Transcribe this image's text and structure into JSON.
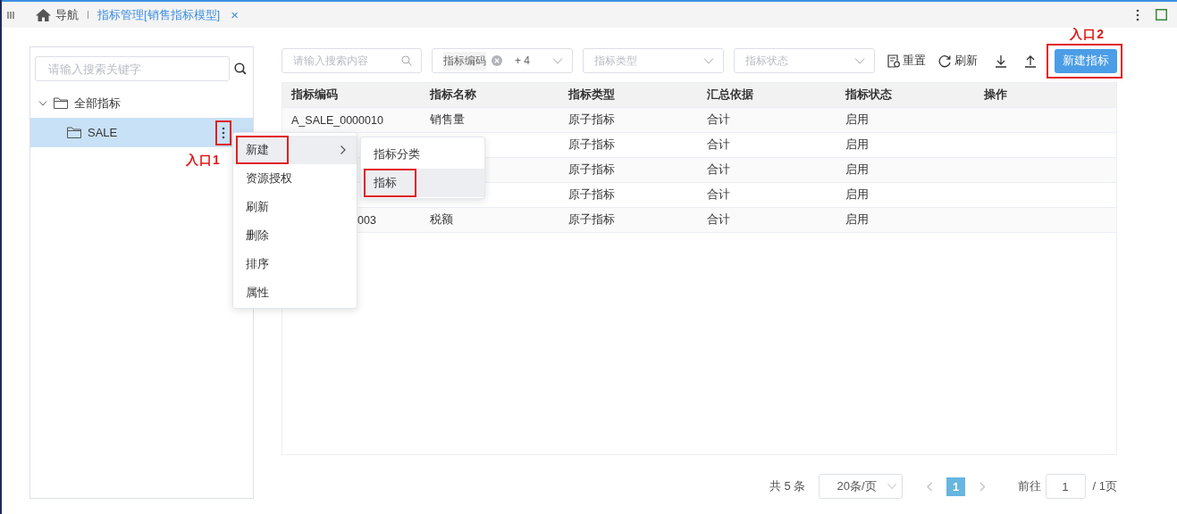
{
  "tabbar": {
    "tabs": [
      {
        "label": "导航",
        "kind": "home",
        "selected": false
      },
      {
        "label": "指标管理[销售指标模型]",
        "kind": "page",
        "selected": true,
        "close": "×"
      }
    ]
  },
  "tree": {
    "placeholder": "请输入搜索关键字",
    "items": [
      {
        "label": "全部指标",
        "expanded": true,
        "selected": false,
        "children": [
          {
            "label": "SALE",
            "selected": true,
            "outlined": true,
            "annotation": "入口1"
          }
        ]
      }
    ]
  },
  "filters": {
    "search_placeholder": "请输入搜索内容",
    "selects": [
      {
        "value": "指标编码",
        "more": "+ 4"
      },
      {
        "placeholder": "指标类型"
      },
      {
        "placeholder": "指标状态"
      }
    ]
  },
  "toolbar": [
    {
      "kind": "reset",
      "label": "重置"
    },
    {
      "kind": "refresh",
      "label": "刷新"
    },
    {
      "kind": "download"
    },
    {
      "kind": "upload"
    }
  ],
  "new_button": {
    "label": "新建指标",
    "outlined": true,
    "annotation": "入口2"
  },
  "table": {
    "columns": [
      "指标编码",
      "指标名称",
      "指标类型",
      "汇总依据",
      "指标状态",
      "操作"
    ],
    "rows": [
      {
        "code": "A_SALE_0000010",
        "name": "销售量",
        "type": "原子指标",
        "basis": "合计",
        "status": "启用"
      },
      {
        "type": "原子指标",
        "basis": "合计",
        "status": "启用"
      },
      {
        "type": "原子指标",
        "basis": "合计",
        "status": "启用"
      },
      {
        "type": "原子指标",
        "basis": "合计",
        "status": "启用"
      },
      {
        "code": "003",
        "code_covered": true,
        "name": "税额",
        "type": "原子指标",
        "basis": "合计",
        "status": "启用"
      }
    ]
  },
  "context_menu": {
    "items": [
      {
        "label": "新建",
        "hover": true,
        "outlined": true,
        "submenu": true
      },
      {
        "label": "资源授权",
        "hover": false,
        "outlined": false,
        "submenu": false
      },
      {
        "label": "刷新",
        "hover": false,
        "outlined": false,
        "submenu": false
      },
      {
        "label": "删除",
        "hover": false,
        "outlined": false,
        "submenu": false
      },
      {
        "label": "排序",
        "hover": false,
        "outlined": false,
        "submenu": false
      },
      {
        "label": "属性",
        "hover": false,
        "outlined": false,
        "submenu": false
      }
    ]
  },
  "submenu": {
    "items": [
      {
        "label": "指标分类",
        "hover": false,
        "outlined": false
      },
      {
        "label": "指标",
        "hover": true,
        "outlined": true
      }
    ]
  },
  "pagination": {
    "total": "共 5 条",
    "page_size": "20条/页",
    "pages": [
      {
        "label": "1",
        "selected": true
      }
    ],
    "goto_label": "前往",
    "goto_value": "1",
    "page_count": "/ 1页"
  }
}
